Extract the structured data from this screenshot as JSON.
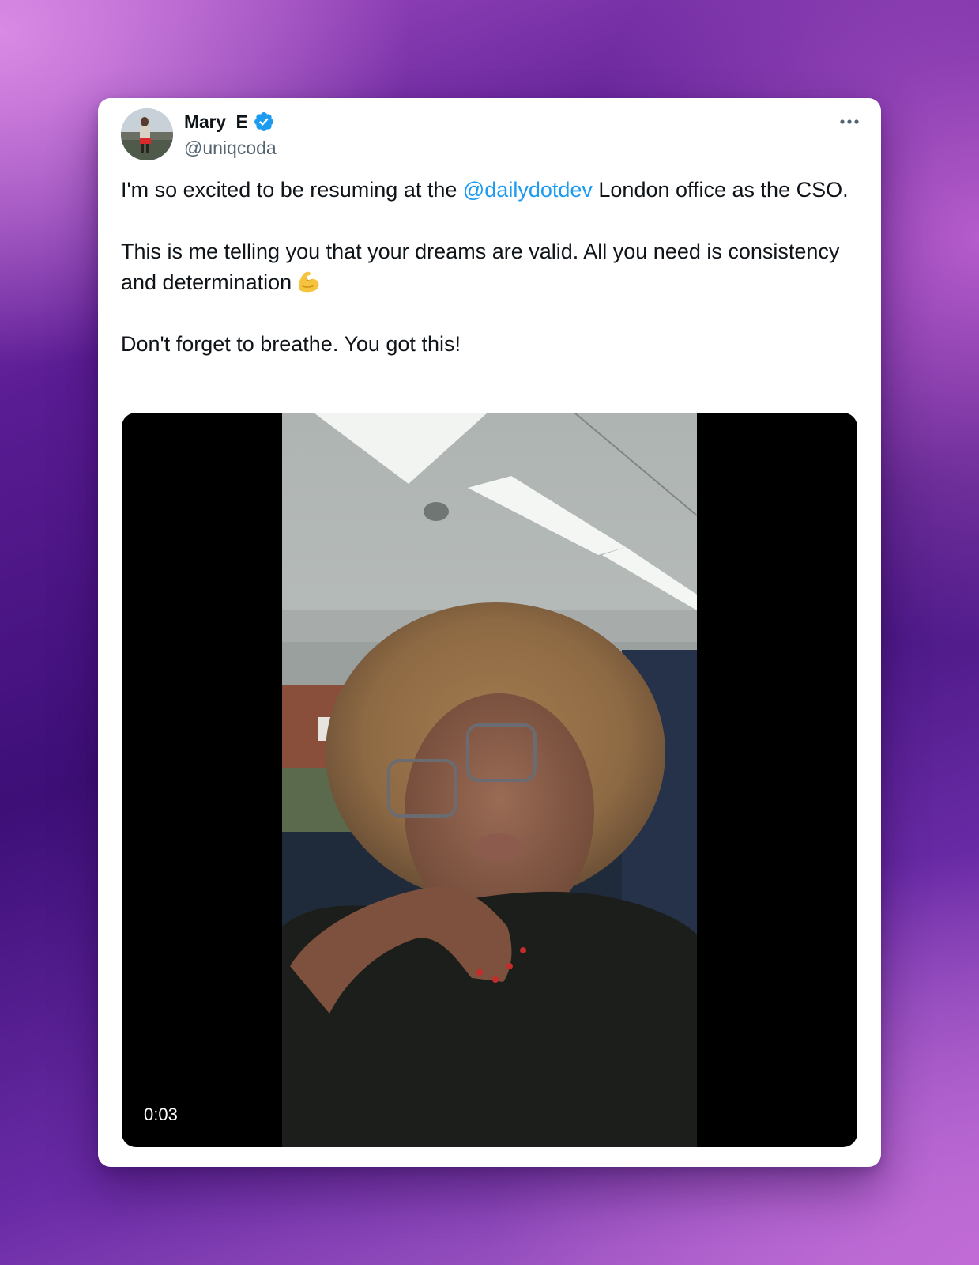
{
  "tweet": {
    "author": {
      "display_name": "Mary_E",
      "handle": "@uniqcoda",
      "verified": true,
      "avatar_icon": "profile-photo"
    },
    "more_icon": "more-horizontal-icon",
    "text": {
      "p1_before": "I'm so excited to be resuming at the ",
      "p1_mention": "@dailydotdev",
      "p1_after": " London office as the CSO.",
      "p2": "This is me telling you that your dreams are valid. All you need is consistency and determination",
      "p2_emoji": "flexed-biceps-emoji",
      "p3": "Don't forget to breathe. You got this!"
    },
    "media": {
      "type": "video",
      "duration": "0:03"
    }
  },
  "colors": {
    "mention": "#1d9bf0",
    "verified": "#1d9bf0",
    "text": "#0f1419",
    "secondary": "#536471"
  }
}
